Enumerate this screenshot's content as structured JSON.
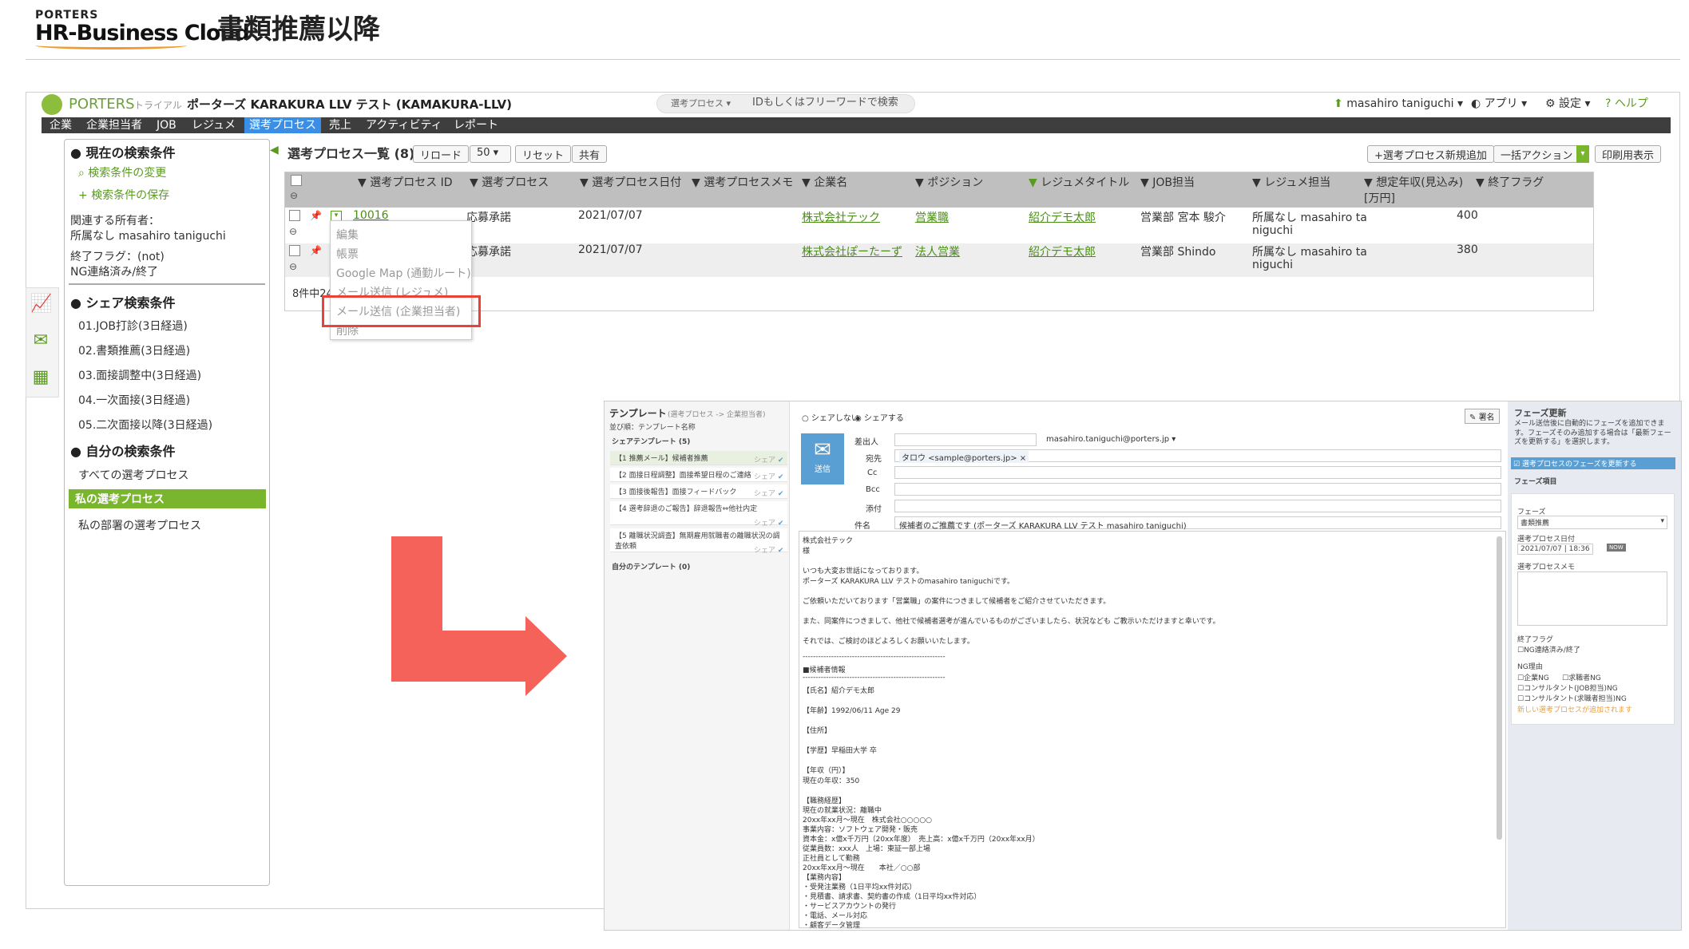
{
  "header": {
    "logo_top": "PORTERS",
    "logo_main": "HR-Business Cloud",
    "title": "書類推薦以降"
  },
  "topbar": {
    "brand": "PORTERS",
    "trial": "トライアル",
    "company": "ポーターズ KARAKURA LLV テスト (KAMAKURA-LLV)",
    "search_type": "選考プロセス",
    "search_placeholder": "IDもしくはフリーワードで検索",
    "user": "masahiro taniguchi",
    "apps": "アプリ",
    "settings": "設定",
    "help": "ヘルプ"
  },
  "nav": [
    "企業",
    "企業担当者",
    "JOB",
    "レジュメ",
    "選考プロセス",
    "売上",
    "アクティビティ",
    "レポート"
  ],
  "sidebar": {
    "current_title": "現在の検索条件",
    "change": "検索条件の変更",
    "save": "検索条件の保存",
    "owner_label": "関連する所有者：",
    "owner_value": "所属なし masahiro taniguchi",
    "flag_label": "終了フラグ：(not)",
    "flag_value": "NG連絡済み/終了",
    "share_title": "シェア検索条件",
    "share_items": [
      "01.JOB打診(3日経過)",
      "02.書類推薦(3日経過)",
      "03.面接調整中(3日経過)",
      "04.一次面接(3日経過)",
      "05.二次面接以降(3日経過)"
    ],
    "my_title": "自分の検索条件",
    "my_items": [
      "すべての選考プロセス",
      "私の選考プロセス",
      "私の部署の選考プロセス"
    ]
  },
  "list": {
    "title": "選考プロセス一覧 (8)",
    "reload": "リロード",
    "per_page": "50",
    "reset": "リセット",
    "share": "共有",
    "add": "+選考プロセス新規追加",
    "bulk": "一括アクション",
    "print": "印刷用表示",
    "columns": [
      "選考プロセス ID",
      "選考プロセス",
      "選考プロセス日付",
      "選考プロセスメモ",
      "企業名",
      "ポジション",
      "レジュメタイトル",
      "JOB担当",
      "レジュメ担当",
      "想定年収(見込み)",
      "終了フラグ"
    ],
    "unit": "[万円]",
    "rows": [
      {
        "id": "10016",
        "process": "応募承諾",
        "date": "2021/07/07",
        "company": "株式会社テック",
        "position": "営業職",
        "resume": "紹介デモ太郎",
        "job_owner": "営業部 宮本 駿介",
        "resume_owner_1": "所属なし masahiro ta",
        "resume_owner_2": "niguchi",
        "salary": "400"
      },
      {
        "id": "",
        "process": "応募承諾",
        "date": "2021/07/07",
        "company": "株式会社ぽーたーず",
        "position": "法人営業",
        "resume": "紹介デモ太郎",
        "job_owner": "営業部 Shindo",
        "resume_owner_1": "所属なし masahiro ta",
        "resume_owner_2": "niguchi",
        "salary": "380"
      }
    ],
    "footer": "8件中24"
  },
  "context_menu": [
    "編集",
    "帳票",
    "Google Map (通勤ルート)",
    "メール送信 (レジュメ)",
    "メール送信 (企業担当者)",
    "削除"
  ],
  "mail": {
    "tpl_title": "テンプレート",
    "tpl_sub": "(選考プロセス -> 企業担当者)",
    "tpl_sort": "並び順：テンプレート名称",
    "tpl_share": "シェアテンプレート (5)",
    "tpl_items": [
      "【1 推薦メール】候補者推薦",
      "【2 面接日程調整】面接希望日程のご連絡",
      "【3 面接後報告】面接フィードバック",
      "【4 選考辞退のご報告】辞退報告⇔他社内定",
      "【5 離職状況調査】無期雇用就職者の離職状況の調査依頼"
    ],
    "tpl_share_tag": "シェア",
    "tpl_mine": "自分のテンプレート (0)",
    "share_no": "シェアしない",
    "share_yes": "シェアする",
    "sign": "署名",
    "sender_label": "差出人",
    "sender": "masahiro.taniguchi@porters.jp",
    "to_label": "宛先",
    "to": "タロウ <sample@porters.jp>",
    "cc": "Cc",
    "bcc": "Bcc",
    "attach": "添付",
    "subject_label": "件名",
    "subject": "候補者のご推薦です (ポーターズ KARAKURA LLV テスト masahiro taniguchi)",
    "send": "送信",
    "body": [
      "株式会社テック",
      "様",
      "",
      "いつも大変お世話になっております。",
      "ポーターズ KARAKURA LLV テストのmasahiro taniguchiです。",
      "",
      "ご依頼いただいております「営業職」の案件につきまして候補者をご紹介させていただきます。",
      "",
      "また、同案件につきまして、他社で候補者選考が進んでいるものがございましたら、状況なども ご教示いただけますと幸いです。",
      "",
      "それでは、ご検討のほどよろしくお願いいたします。",
      "",
      "-------------------------------------------------------",
      "■候補者情報",
      "-------------------------------------------------------",
      "【氏名】紹介デモ太郎",
      "",
      "【年齢】1992/06/11 Age 29",
      "",
      "【住所】",
      "",
      "【学歴】早稲田大学 卒",
      "",
      "【年収（円）】",
      "現在の年収：350",
      "",
      "【職務経歴】",
      "現在の就業状況：離職中",
      "20xx年xx月～現在　株式会社○○○○○",
      "事業内容：ソフトウェア開発・販売",
      "資本金：x億x千万円（20xx年度）　売上高：x億x千万円（20xx年xx月）",
      "従業員数：xxx人　上場：東証一部上場",
      "正社員として勤務",
      "20xx年xx月～現在　　本社／○○部",
      "【業務内容】",
      "・受発注業務（1日平均xx件対応）",
      "・見積書、請求書、契約書の作成（1日平均xx件対応）",
      "・サービスアカウントの発行",
      "・電話、メール対応",
      "・顧客データ管理"
    ],
    "phase_title": "フェーズ更新",
    "phase_desc": "メール送信後に自動的にフェーズを追加できます。フェーズそのみ追加する場合は「最新フェーズを更新する」を選択します。",
    "phase_update": "選考プロセスのフェーズを更新する",
    "phase_items": "フェーズ項目",
    "phase_label": "フェーズ",
    "phase_value": "書類推薦",
    "phase_date_label": "選考プロセス日付",
    "phase_date": "2021/07/07",
    "phase_time": "18:36",
    "phase_now": "NOW",
    "phase_memo": "選考プロセスメモ",
    "end_flag": "終了フラグ",
    "end_ng": "NG連絡済み/終了",
    "ng_reason": "NG理由",
    "ng_items": [
      "企業NG",
      "求職者NG",
      "コンサルタント(JOB担当)NG",
      "コンサルタント(求職者担当)NG"
    ],
    "ng_note": "新しい選考プロセスが追加されます"
  }
}
